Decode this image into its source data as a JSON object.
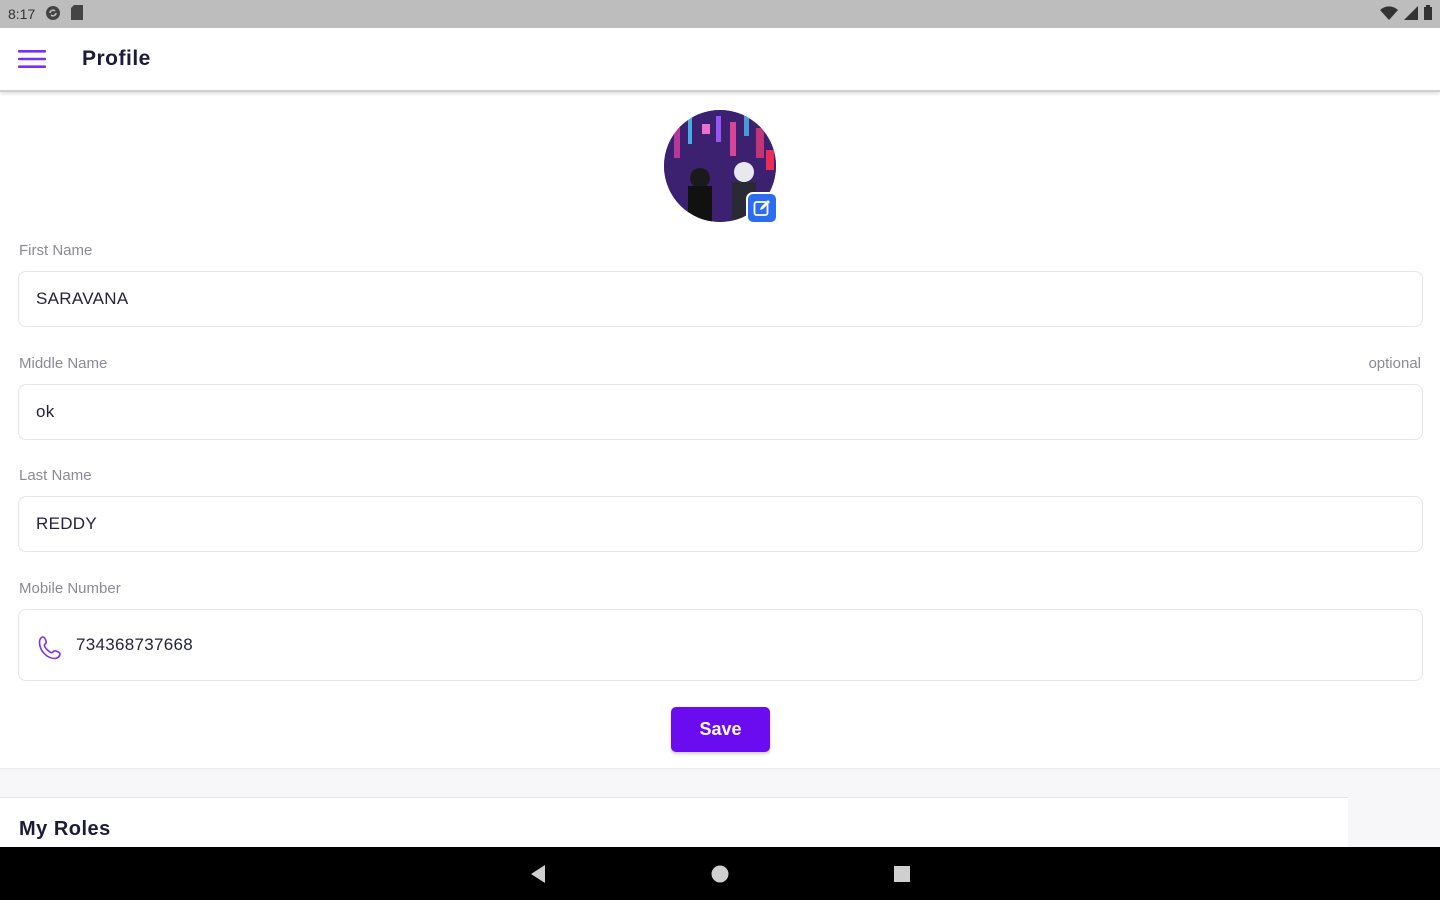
{
  "status_bar": {
    "time": "8:17",
    "icons_left": [
      "sync-icon",
      "sim-card-icon"
    ],
    "icons_right": [
      "wifi-icon",
      "signal-icon",
      "battery-icon"
    ]
  },
  "app_bar": {
    "title": "Profile",
    "menu_icon": "hamburger-menu-icon"
  },
  "profile": {
    "avatar_icon": "profile-avatar",
    "edit_icon": "edit-pencil-icon"
  },
  "form": {
    "first_name": {
      "label": "First Name",
      "value": "SARAVANA"
    },
    "middle_name": {
      "label": "Middle Name",
      "hint": "optional",
      "value": "ok"
    },
    "last_name": {
      "label": "Last Name",
      "value": "REDDY"
    },
    "mobile": {
      "label": "Mobile Number",
      "value": "734368737668",
      "icon": "phone-icon"
    },
    "save_label": "Save"
  },
  "roles": {
    "title": "My Roles"
  },
  "nav_bar": {
    "buttons": [
      "back-icon",
      "home-icon",
      "recents-icon"
    ]
  },
  "colors": {
    "accent": "#6a0bf0",
    "edit_badge": "#2c6df0",
    "text_primary": "#1d1b3a",
    "label_gray": "#8a8a96"
  }
}
